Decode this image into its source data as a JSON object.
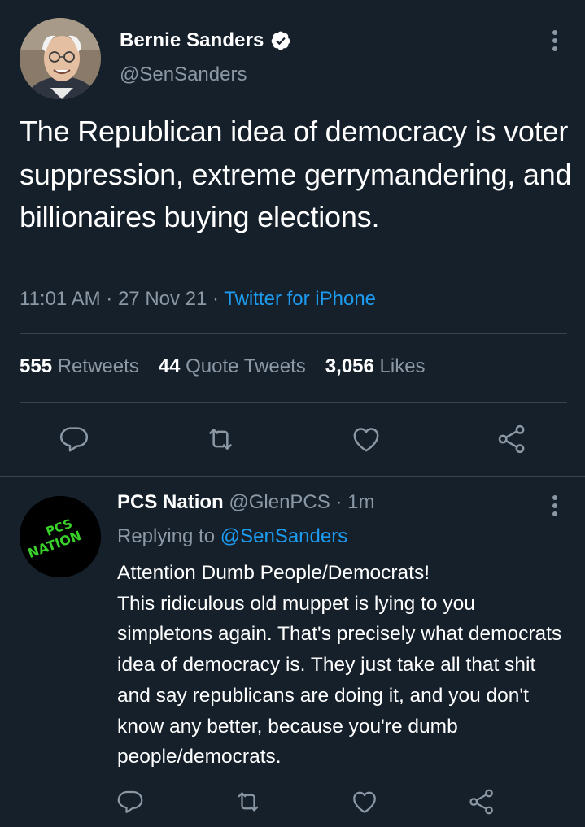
{
  "main_tweet": {
    "author": {
      "display_name": "Bernie Sanders",
      "handle": "@SenSanders",
      "verified": true
    },
    "text": "The Republican idea of democracy is voter suppression, extreme gerrymandering, and billionaires buying elections.",
    "time": "11:01 AM",
    "date": "27 Nov 21",
    "source": "Twitter for iPhone",
    "separator": " · ",
    "stats": {
      "retweets_count": "555",
      "retweets_label": "Retweets",
      "quotes_count": "44",
      "quotes_label": "Quote Tweets",
      "likes_count": "3,056",
      "likes_label": "Likes"
    },
    "actions": [
      "reply-icon",
      "retweet-icon",
      "like-icon",
      "share-icon"
    ]
  },
  "reply_tweet": {
    "author": {
      "display_name": "PCS Nation",
      "handle": "@GlenPCS",
      "avatar_text": "PCS NATION"
    },
    "dot": " · ",
    "time": "1m",
    "replying_label": "Replying to",
    "replying_to": "@SenSanders",
    "text": "Attention Dumb People/Democrats!\nThis ridiculous old muppet is lying to you simpletons again. That's precisely what democrats idea of democracy is. They just take all that shit and say republicans are doing it, and you don't know any better, because you're dumb people/democrats.",
    "actions": [
      "reply-icon",
      "retweet-icon",
      "like-icon",
      "share-icon"
    ]
  },
  "colors": {
    "background": "#15202b",
    "primary_text": "#ffffff",
    "secondary_text": "#8b98a5",
    "accent": "#1d9bf0",
    "divider": "#38444d",
    "avatar_text_green": "#39d12a"
  }
}
